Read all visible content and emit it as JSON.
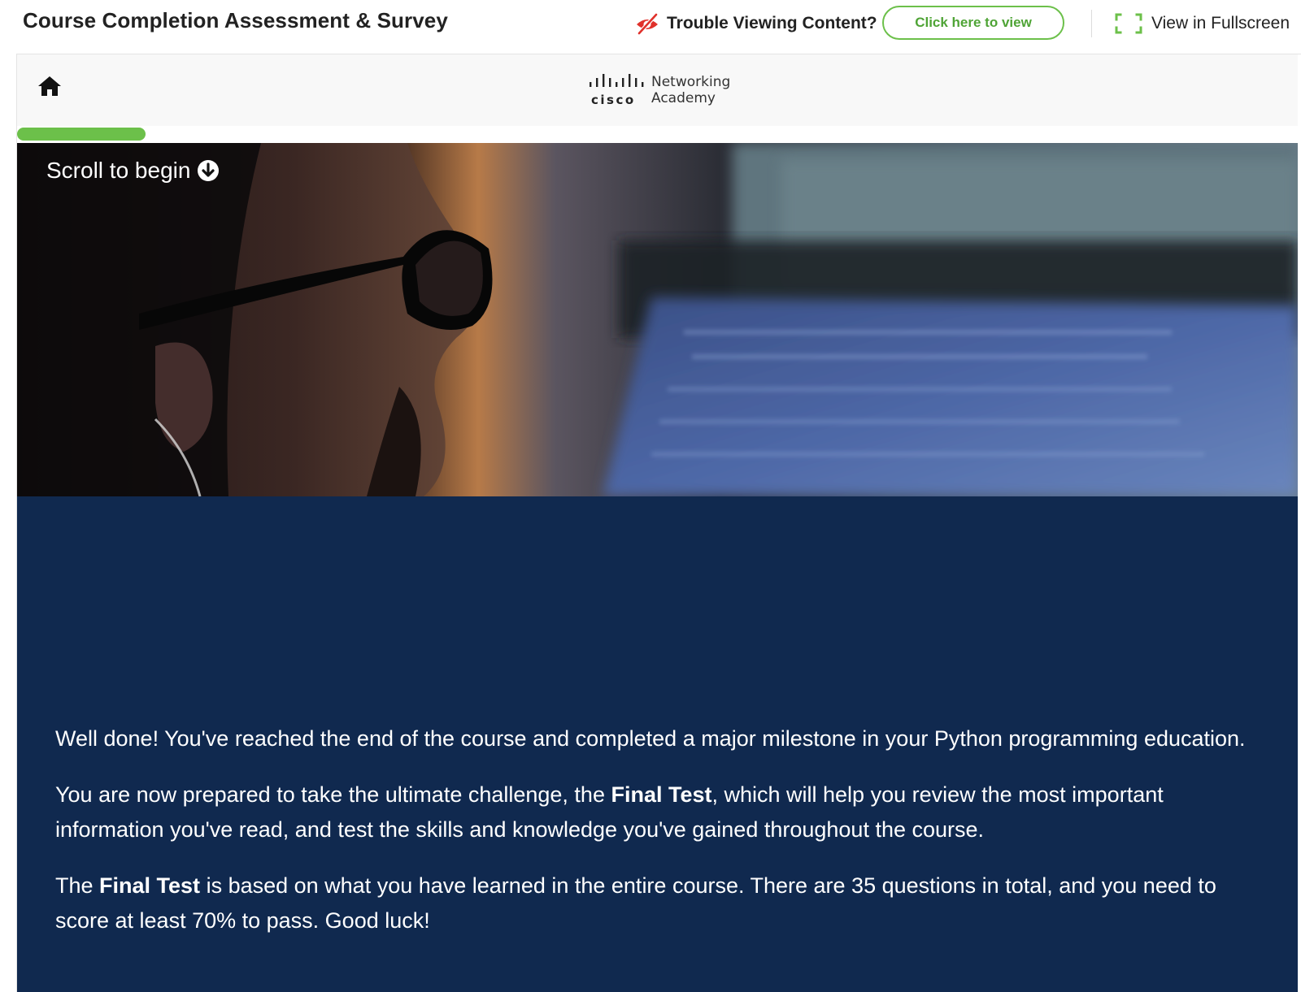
{
  "header": {
    "title": "Course Completion Assessment & Survey",
    "trouble_text": "Trouble Viewing Content?",
    "click_view_label": "Click here to view",
    "fullscreen_label": "View in Fullscreen",
    "icons": {
      "trouble": "eye-slash-icon",
      "fullscreen": "fullscreen-icon"
    },
    "accent_color": "#6cc04a",
    "trouble_icon_color": "#e0312b"
  },
  "nav": {
    "home_icon": "home-icon",
    "logo": {
      "brand": "cisco",
      "line1": "Networking",
      "line2": "Academy"
    }
  },
  "progress": {
    "fraction": 0.1,
    "color": "#6cc04a"
  },
  "hero": {
    "scroll_label": "Scroll to begin",
    "scroll_icon": "arrow-down-circle-icon"
  },
  "intro": {
    "background": "#10294f",
    "p1": "Well done! You've reached the end of the course and completed a major milestone in your Python programming education.",
    "p2": {
      "before": "You are now prepared to take the ultimate challenge, the ",
      "bold": "Final Test",
      "after": ", which will help you review the most important information you've read, and test the skills and knowledge you've gained throughout the course."
    },
    "p3": {
      "before": "The ",
      "bold": "Final Test",
      "after": " is based on what you have learned in the entire course. There are 35 questions in total, and you need to score at least 70% to pass. Good luck!"
    }
  }
}
